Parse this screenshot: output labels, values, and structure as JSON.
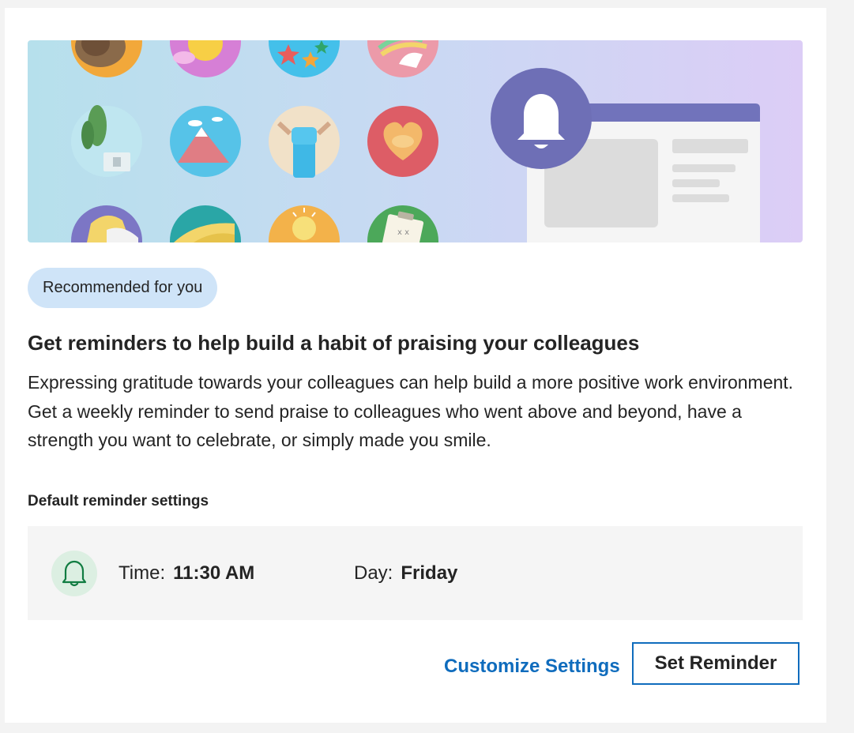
{
  "banner": {
    "alt_icons": [
      "lion-badge-icon",
      "sun-badge-icon",
      "stars-badge-icon",
      "unicorn-badge-icon",
      "plant-badge-icon",
      "mountain-badge-icon",
      "fist-badge-icon",
      "handshake-heart-badge-icon",
      "wave-badge-icon",
      "helping-hand-badge-icon",
      "lightbulb-badge-icon",
      "clipboard-badge-icon",
      "notification-bell-icon"
    ]
  },
  "recommendation": {
    "badge": "Recommended for you",
    "title": "Get reminders to help build a habit of praising your colleagues",
    "description": "Expressing gratitude towards your colleagues can help build a more positive work environment. Get a weekly reminder to send praise to colleagues who went above and beyond, have a strength you want to celebrate, or simply made you smile."
  },
  "settings": {
    "label": "Default reminder settings",
    "time_label": "Time:",
    "time_value": "11:30 AM",
    "day_label": "Day:",
    "day_value": "Friday"
  },
  "actions": {
    "customize": "Customize Settings",
    "set_reminder": "Set Reminder"
  },
  "colors": {
    "accent": "#0f6cbd",
    "bell_green": "#107c41",
    "badge_bg": "#cfe4f8"
  }
}
